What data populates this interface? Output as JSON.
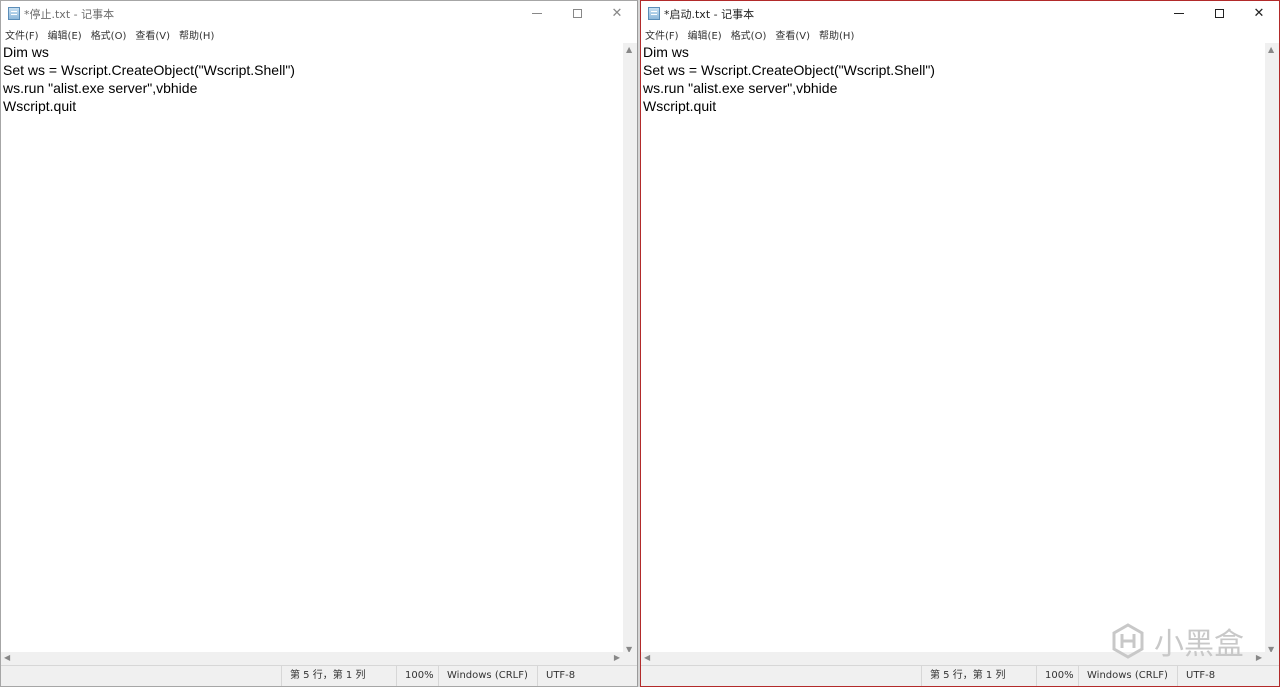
{
  "windows": [
    {
      "title": "*停止.txt - 记事本",
      "menu": [
        "文件(F)",
        "编辑(E)",
        "格式(O)",
        "查看(V)",
        "帮助(H)"
      ],
      "lines": [
        "Dim ws",
        "Set ws = Wscript.CreateObject(\"Wscript.Shell\")",
        "ws.run \"alist.exe server\",vbhide",
        "Wscript.quit"
      ],
      "status": {
        "position": "第 5 行，第 1 列",
        "zoom": "100%",
        "eol": "Windows (CRLF)",
        "encoding": "UTF-8"
      }
    },
    {
      "title": "*启动.txt - 记事本",
      "menu": [
        "文件(F)",
        "编辑(E)",
        "格式(O)",
        "查看(V)",
        "帮助(H)"
      ],
      "lines": [
        "Dim ws",
        "Set ws = Wscript.CreateObject(\"Wscript.Shell\")",
        "ws.run \"alist.exe server\",vbhide",
        "Wscript.quit"
      ],
      "status": {
        "position": "第 5 行，第 1 列",
        "zoom": "100%",
        "eol": "Windows (CRLF)",
        "encoding": "UTF-8"
      }
    }
  ],
  "watermark": {
    "text": "小黑盒"
  },
  "colors": {
    "active_border": "#b22a2a",
    "statusbar_bg": "#f0f0f0"
  },
  "icons": [
    "notepad-icon",
    "minimize-icon",
    "maximize-icon",
    "close-icon",
    "scroll-up-icon",
    "scroll-down-icon",
    "scroll-left-icon",
    "scroll-right-icon",
    "heybox-logo-icon"
  ]
}
